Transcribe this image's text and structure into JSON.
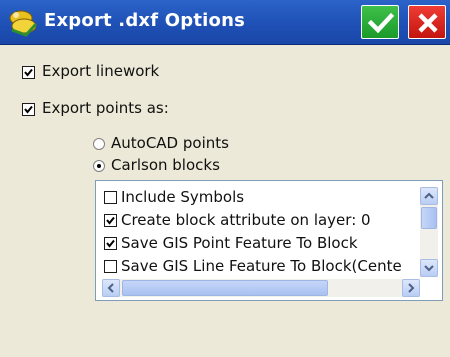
{
  "window": {
    "title": "Export .dxf Options",
    "ok_icon": "checkmark-icon",
    "cancel_icon": "x-icon",
    "colors": {
      "titlebar": "#1e4fb4",
      "ok": "#1fa22e",
      "cancel": "#d4201a"
    }
  },
  "options": {
    "export_linework": {
      "label": "Export linework",
      "checked": true
    },
    "export_points_as": {
      "label": "Export points as:",
      "checked": true
    }
  },
  "point_format": {
    "options": [
      {
        "label": "AutoCAD points",
        "selected": false
      },
      {
        "label": "Carlson blocks",
        "selected": true
      }
    ]
  },
  "block_options": {
    "items": [
      {
        "label": "Include Symbols",
        "checked": false
      },
      {
        "label": "Create block attribute on layer: 0",
        "checked": true
      },
      {
        "label": "Save GIS Point Feature To Block",
        "checked": true
      },
      {
        "label": "Save GIS Line Feature To Block(Cente",
        "checked": false
      }
    ]
  }
}
